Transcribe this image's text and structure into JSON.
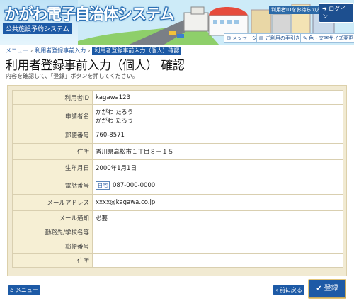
{
  "header": {
    "title": "かがわ電子自治体システム",
    "subtitle": "公共施設予約システム",
    "login_hint": "利用者IDをお持ちの方",
    "login_label": "ログイン",
    "toolbar": {
      "message": "メッセージ",
      "guide": "ご利用の手引き",
      "color_size": "色・文字サイズ変更"
    }
  },
  "breadcrumb": [
    "メニュー",
    "利用者登録事前入力",
    "利用者登録事前入力（個人）確認"
  ],
  "page_title": "利用者登録事前入力（個人） 確認",
  "instruction": "内容を確認して、「登録」ボタンを押してください。",
  "form": {
    "rows": [
      {
        "label": "利用者ID",
        "value": "kagawa123"
      },
      {
        "label": "申請者名",
        "value": "かがわ たろう",
        "value2": "かがわ たろう"
      },
      {
        "label": "郵便番号",
        "value": "760-8571"
      },
      {
        "label": "住所",
        "value": "香川県高松市１丁目８－１５"
      },
      {
        "label": "生年月日",
        "value": "2000年1月1日"
      },
      {
        "label": "電話番号",
        "tag": "自宅",
        "value": "087-000-0000"
      },
      {
        "label": "メールアドレス",
        "value": "xxxx@kagawa.co.jp"
      },
      {
        "label": "メール通知",
        "value": "必要"
      },
      {
        "label": "勤務先/学校名等",
        "value": ""
      },
      {
        "label": "郵便番号",
        "value": ""
      },
      {
        "label": "住所",
        "value": ""
      }
    ]
  },
  "footer": {
    "menu_label": "メニュー",
    "back_label": "前に戻る",
    "register_label": "登録"
  },
  "colors": {
    "brand_blue": "#1d5aa6",
    "form_bg": "#f1ead2",
    "label_bg": "#f6efd4"
  }
}
